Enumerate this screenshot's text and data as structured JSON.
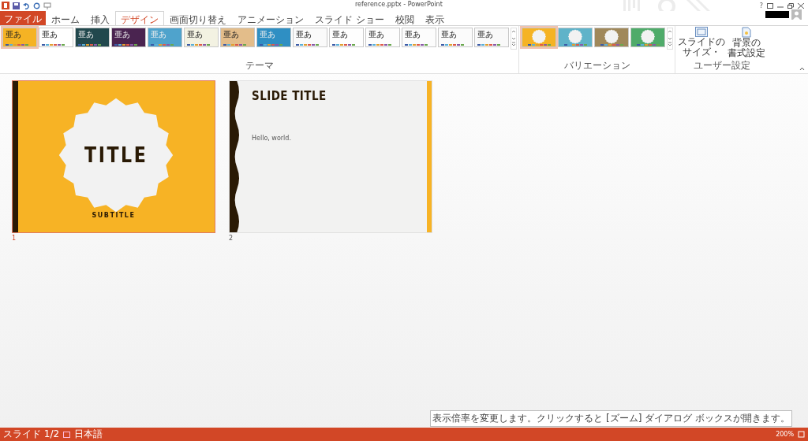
{
  "window": {
    "title": "reference.pptx - PowerPoint",
    "help": "?"
  },
  "tabs": [
    {
      "label": "ファイル",
      "kind": "file",
      "selected": false
    },
    {
      "label": "ホーム",
      "kind": "tab",
      "selected": false
    },
    {
      "label": "挿入",
      "kind": "tab",
      "selected": false
    },
    {
      "label": "デザイン",
      "kind": "tab",
      "selected": true
    },
    {
      "label": "画面切り替え",
      "kind": "tab",
      "selected": false
    },
    {
      "label": "アニメーション",
      "kind": "tab",
      "selected": false
    },
    {
      "label": "スライド ショー",
      "kind": "tab",
      "selected": false
    },
    {
      "label": "校閲",
      "kind": "tab",
      "selected": false
    },
    {
      "label": "表示",
      "kind": "tab",
      "selected": false
    }
  ],
  "themes": {
    "label": "テーマ",
    "items": [
      {
        "text": "亜あ",
        "color": "#f5b324",
        "selected": true
      },
      {
        "text": "亜あ",
        "color": "#ffffff",
        "selected": false
      },
      {
        "text": "亜あ",
        "color": "#21484d",
        "selected": false
      },
      {
        "text": "亜あ",
        "color": "#4a2450",
        "selected": false
      },
      {
        "text": "亜あ",
        "color": "#4fa3cc",
        "selected": false
      },
      {
        "text": "亜あ",
        "color": "#f3f2e2",
        "selected": false
      },
      {
        "text": "亜あ",
        "color": "#e3bd8a",
        "selected": false
      },
      {
        "text": "亜あ",
        "color": "#2f8fc3",
        "selected": false
      },
      {
        "text": "亜あ",
        "color": "#fafafa",
        "selected": false
      },
      {
        "text": "亜あ",
        "color": "#fefefe",
        "selected": false
      },
      {
        "text": "亜あ",
        "color": "#fdfdfd",
        "selected": false
      },
      {
        "text": "亜あ",
        "color": "#fcfcfc",
        "selected": false
      },
      {
        "text": "亜あ",
        "color": "#fbfbfb",
        "selected": false
      },
      {
        "text": "亜あ",
        "color": "#f9f9f9",
        "selected": false
      }
    ]
  },
  "variants": {
    "label": "バリエーション",
    "items": [
      {
        "color": "#f5b324",
        "selected": true
      },
      {
        "color": "#5fb3c9",
        "selected": false
      },
      {
        "color": "#a0885a",
        "selected": false
      },
      {
        "color": "#4fab6a",
        "selected": false
      }
    ]
  },
  "customize": {
    "label": "ユーザー設定",
    "buttons": [
      {
        "line1": "スライドの",
        "line2": "サイズ・"
      },
      {
        "line1": "背景の",
        "line2": "書式設定"
      }
    ]
  },
  "slides": [
    {
      "number": "1",
      "kind": "title",
      "selected": true,
      "title": "TITLE",
      "subtitle": "SUBTITLE"
    },
    {
      "number": "2",
      "kind": "content",
      "selected": false,
      "title": "SLIDE TITLE",
      "body": "Hello, world."
    }
  ],
  "status_bar": {
    "slide": "スライド 1/2",
    "language": "日本語",
    "zoom": "200%",
    "tooltip": "表示倍率を変更します。クリックすると [ズーム] ダイアログ ボックスが開きます。"
  }
}
